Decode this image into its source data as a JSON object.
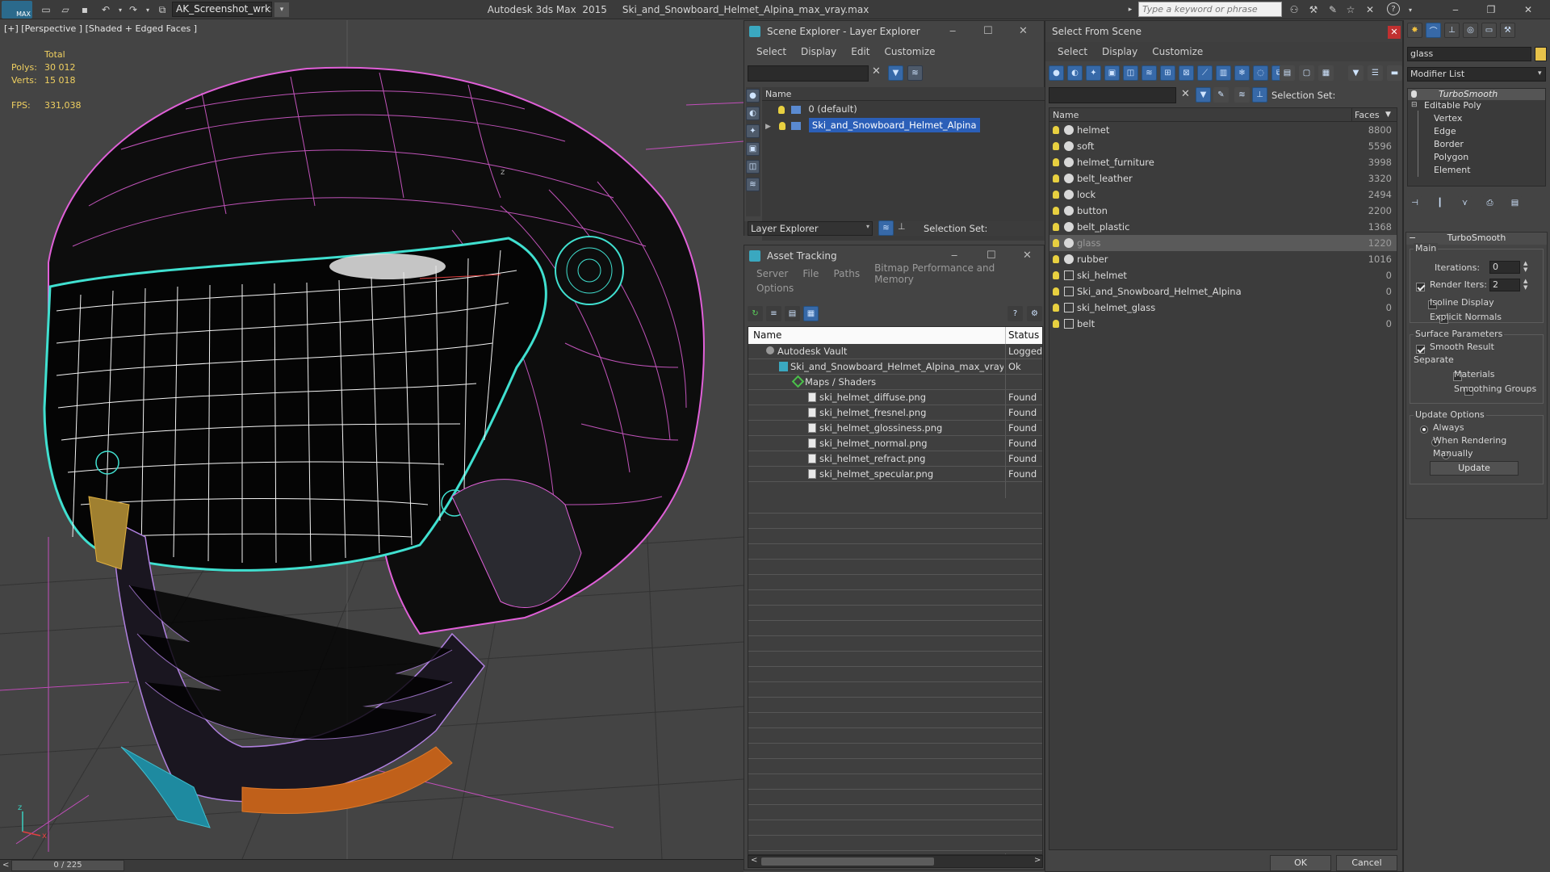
{
  "titlebar": {
    "workspace": "AK_Screenshot_wrksp",
    "app_title": "Autodesk 3ds Max  2015     Ski_and_Snowboard_Helmet_Alpina_max_vray.max",
    "search_placeholder": "Type a keyword or phrase",
    "logo": "MAX"
  },
  "viewport": {
    "label": "[+] [Perspective ] [Shaded + Edged Faces ]",
    "stats": {
      "total_label": "Total",
      "polys_label": "Polys:",
      "polys_value": "30 012",
      "verts_label": "Verts:",
      "verts_value": "15 018",
      "fps_label": "FPS:",
      "fps_value": "331,038"
    },
    "axis_x": "x",
    "axis_z": "z",
    "time_slider": "0 / 225"
  },
  "scene_explorer": {
    "title": "Scene Explorer - Layer Explorer",
    "menu": [
      "Select",
      "Display",
      "Edit",
      "Customize"
    ],
    "col_name": "Name",
    "layers": [
      "0 (default)",
      "Ski_and_Snowboard_Helmet_Alpina"
    ],
    "footer_dropdown": "Layer Explorer",
    "selection_set_label": "Selection Set:"
  },
  "asset_tracking": {
    "title": "Asset Tracking",
    "menu": [
      "Server",
      "File",
      "Paths",
      "Bitmap Performance and Memory"
    ],
    "menu2": [
      "Options"
    ],
    "col_name": "Name",
    "col_status": "Status",
    "rows": [
      {
        "name": "Autodesk Vault",
        "status": "Logged"
      },
      {
        "name": "Ski_and_Snowboard_Helmet_Alpina_max_vray....",
        "status": "Ok"
      },
      {
        "name": "Maps / Shaders",
        "status": ""
      },
      {
        "name": "ski_helmet_diffuse.png",
        "status": "Found"
      },
      {
        "name": "ski_helmet_fresnel.png",
        "status": "Found"
      },
      {
        "name": "ski_helmet_glossiness.png",
        "status": "Found"
      },
      {
        "name": "ski_helmet_normal.png",
        "status": "Found"
      },
      {
        "name": "ski_helmet_refract.png",
        "status": "Found"
      },
      {
        "name": "ski_helmet_specular.png",
        "status": "Found"
      }
    ]
  },
  "select_from_scene": {
    "title": "Select From Scene",
    "menu": [
      "Select",
      "Display",
      "Customize"
    ],
    "selection_set_label": "Selection Set:",
    "col_name": "Name",
    "col_faces": "Faces",
    "objects": [
      {
        "name": "helmet",
        "faces": "8800"
      },
      {
        "name": "soft",
        "faces": "5596"
      },
      {
        "name": "helmet_furniture",
        "faces": "3998"
      },
      {
        "name": "belt_leather",
        "faces": "3320"
      },
      {
        "name": "lock",
        "faces": "2494"
      },
      {
        "name": "button",
        "faces": "2200"
      },
      {
        "name": "belt_plastic",
        "faces": "1368"
      },
      {
        "name": "glass",
        "faces": "1220"
      },
      {
        "name": "rubber",
        "faces": "1016"
      },
      {
        "name": "ski_helmet",
        "faces": "0"
      },
      {
        "name": "Ski_and_Snowboard_Helmet_Alpina",
        "faces": "0"
      },
      {
        "name": "ski_helmet_glass",
        "faces": "0"
      },
      {
        "name": "belt",
        "faces": "0"
      }
    ],
    "ok_label": "OK",
    "cancel_label": "Cancel"
  },
  "command_panel": {
    "object_name": "glass",
    "modifier_list": "Modifier List",
    "stack": [
      "TurboSmooth",
      "Editable Poly",
      "Vertex",
      "Edge",
      "Border",
      "Polygon",
      "Element"
    ],
    "rollout_title": "TurboSmooth",
    "main_label": "Main",
    "iterations_label": "Iterations:",
    "iterations_value": "0",
    "render_iters_label": "Render Iters:",
    "render_iters_value": "2",
    "isoline_label": "Isoline Display",
    "explicit_normals_label": "Explicit Normals",
    "surface_params_label": "Surface Parameters",
    "smooth_result_label": "Smooth Result",
    "separate_label": "Separate",
    "materials_label": "Materials",
    "smoothing_groups_label": "Smoothing Groups",
    "update_options_label": "Update Options",
    "always_label": "Always",
    "when_rendering_label": "When Rendering",
    "manually_label": "Manually",
    "update_button": "Update",
    "object_color": "#e8c34a"
  },
  "colors": {
    "selection_blue": "#2b5fb8",
    "wire_magenta": "#e060d8",
    "wire_cyan": "#40e0d0",
    "stat_yellow": "#f0d060"
  }
}
